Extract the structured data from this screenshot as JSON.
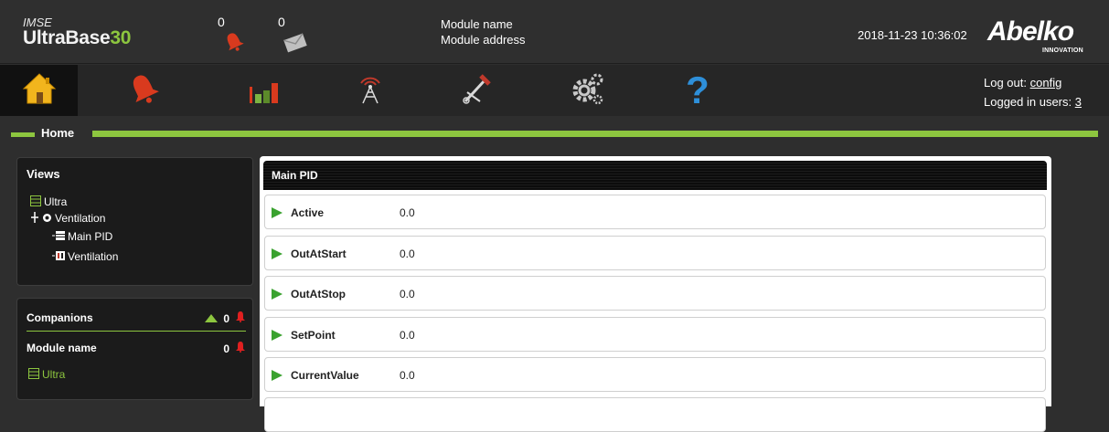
{
  "header": {
    "brand_prefix": "IMSE",
    "brand_name": "UltraBase",
    "brand_number": "30",
    "alarm_count": "0",
    "message_count": "0",
    "module_name": "Module name",
    "module_address": "Module address",
    "datetime": "2018-11-23 10:36:02",
    "logo_name": "Abelko",
    "logo_sub": "INNOVATION"
  },
  "nav": {
    "items": [
      {
        "icon": "home-icon"
      },
      {
        "icon": "alarm-bell-icon"
      },
      {
        "icon": "bar-chart-icon"
      },
      {
        "icon": "antenna-icon"
      },
      {
        "icon": "tools-icon"
      },
      {
        "icon": "gears-icon"
      },
      {
        "icon": "help-icon"
      }
    ],
    "logout_label": "Log out:",
    "logout_user": "config",
    "logged_in_label": "Logged in users:",
    "logged_in_count": "3"
  },
  "section": {
    "title": "Home"
  },
  "views": {
    "title": "Views",
    "tree": [
      "Ultra",
      "Ventilation",
      "Main PID",
      "Ventilation"
    ]
  },
  "companions": {
    "title": "Companions",
    "count": "0",
    "module_label": "Module name",
    "module_count": "0",
    "link": "Ultra"
  },
  "main": {
    "title": "Main PID",
    "rows": [
      {
        "name": "Active",
        "value": "0.0"
      },
      {
        "name": "OutAtStart",
        "value": "0.0"
      },
      {
        "name": "OutAtStop",
        "value": "0.0"
      },
      {
        "name": "SetPoint",
        "value": "0.0"
      },
      {
        "name": "CurrentValue",
        "value": "0.0"
      }
    ]
  },
  "colors": {
    "accent": "#8dc63f",
    "arrow": "#3aa22f",
    "alarm": "#e02020",
    "home": "#f2b51d"
  }
}
